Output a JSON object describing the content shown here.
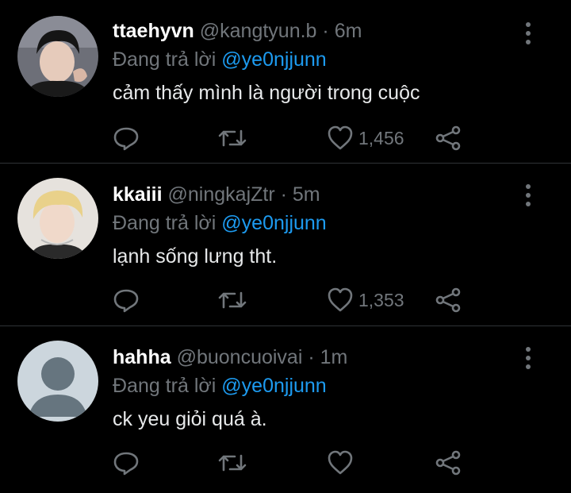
{
  "tweets": [
    {
      "name": "ttaehyvn",
      "handle": "@kangtyun.b",
      "dot": "·",
      "time": "6m",
      "reply_prefix": "Đang trả lời",
      "reply_to": "@ye0njjunn",
      "text": "cảm thấy mình là người trong cuộc",
      "likes": "1,456"
    },
    {
      "name": "kkaiii",
      "handle": "@ningkajZtr",
      "dot": "·",
      "time": "5m",
      "reply_prefix": "Đang trả lời",
      "reply_to": "@ye0njjunn",
      "text": "lạnh sống lưng tht.",
      "likes": "1,353"
    },
    {
      "name": "hahha",
      "handle": "@buoncuoivai",
      "dot": "·",
      "time": "1m",
      "reply_prefix": "Đang trả lời",
      "reply_to": "@ye0njjunn",
      "text": "ck yeu giỏi quá à.",
      "likes": ""
    }
  ],
  "colors": {
    "background": "#000000",
    "muted": "#71767b",
    "accent": "#1d9bf0",
    "divider": "#2f3336"
  },
  "icons": [
    "reply-icon",
    "retweet-icon",
    "like-icon",
    "share-icon",
    "more-icon"
  ]
}
